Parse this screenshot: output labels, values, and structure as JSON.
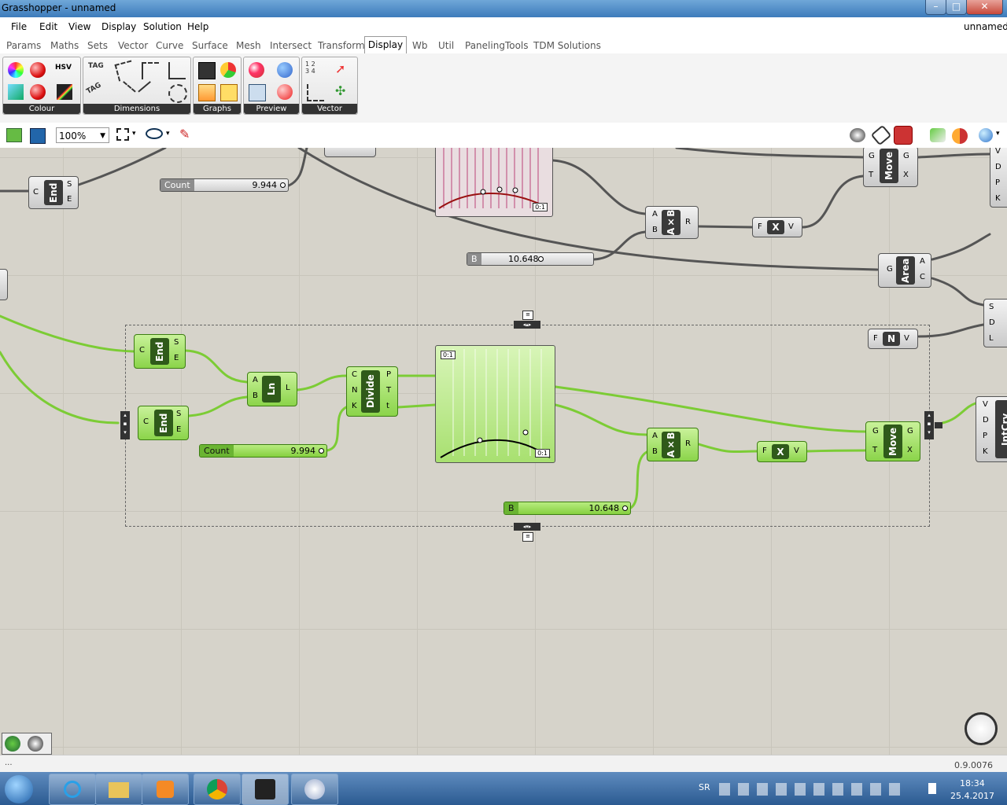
{
  "window": {
    "title": "Grasshopper - unnamed",
    "doc_name": "unnamed",
    "min": "–",
    "max": "□",
    "close": "✕"
  },
  "menu": [
    "File",
    "Edit",
    "View",
    "Display",
    "Solution",
    "Help"
  ],
  "tabs": [
    "Params",
    "Maths",
    "Sets",
    "Vector",
    "Curve",
    "Surface",
    "Mesh",
    "Intersect",
    "Transform",
    "Display",
    "Wb",
    "Util",
    "PanelingTools",
    "TDM Solutions"
  ],
  "active_tab": "Display",
  "ribbon_panels": [
    "Colour",
    "Dimensions",
    "Graphs",
    "Preview",
    "Vector"
  ],
  "ribbon_icon_text": {
    "hsv": "HSV",
    "tag1": "TAG",
    "tag2": "TAG",
    "nums": "1 2 3 4"
  },
  "toolbar": {
    "zoom": "100%"
  },
  "canvas": {
    "grey": {
      "end": {
        "label": "End",
        "in": "C",
        "out1": "S",
        "out2": "E"
      },
      "count": {
        "label": "Count",
        "value": "9.944"
      },
      "b": {
        "label": "B",
        "value": "10.648"
      },
      "axb": {
        "label": "A×B",
        "in1": "A",
        "in2": "B",
        "out": "R"
      },
      "x": {
        "label": "X",
        "in": "F",
        "out": "V"
      },
      "move": {
        "label": "Move",
        "in1": "G",
        "in2": "T",
        "out1": "G",
        "out2": "X"
      },
      "area": {
        "label": "Area",
        "in": "G",
        "out1": "A",
        "out2": "C"
      },
      "n": {
        "label": "N",
        "in": "F",
        "out": "V"
      },
      "graph_tag": "0:1",
      "right_ports": [
        "V",
        "D",
        "P",
        "K"
      ],
      "right_ports2": [
        "S",
        "D",
        "L"
      ]
    },
    "green": {
      "end1": {
        "label": "End",
        "in": "C",
        "out1": "S",
        "out2": "E"
      },
      "end2": {
        "label": "End",
        "in": "C",
        "out1": "S",
        "out2": "E"
      },
      "ln": {
        "label": "Ln",
        "in1": "A",
        "in2": "B",
        "out": "L"
      },
      "divide": {
        "label": "Divide",
        "in1": "C",
        "in2": "N",
        "in3": "K",
        "out1": "P",
        "out2": "T",
        "out3": "t"
      },
      "count": {
        "label": "Count",
        "value": "9.994"
      },
      "b": {
        "label": "B",
        "value": "10.648"
      },
      "axb": {
        "label": "A×B",
        "in1": "A",
        "in2": "B",
        "out": "R"
      },
      "x": {
        "label": "X",
        "in": "F",
        "out": "V"
      },
      "move": {
        "label": "Move",
        "in1": "G",
        "in2": "T",
        "out1": "G",
        "out2": "X"
      },
      "graph_tag1": "0:1",
      "graph_tag2": "0:1"
    },
    "intcrv": {
      "label": "IntCrv",
      "ports": [
        "V",
        "D",
        "P",
        "K"
      ]
    }
  },
  "status": {
    "version": "0.9.0076",
    "left": "..."
  },
  "taskbar": {
    "lang": "SR",
    "time": "18:34",
    "date": "25.4.2017"
  },
  "colors": {
    "accent_green": "#8bd44a",
    "wire_grey": "#555555",
    "wire_green": "#7ccc35",
    "canvas": "#d6d3ca"
  }
}
